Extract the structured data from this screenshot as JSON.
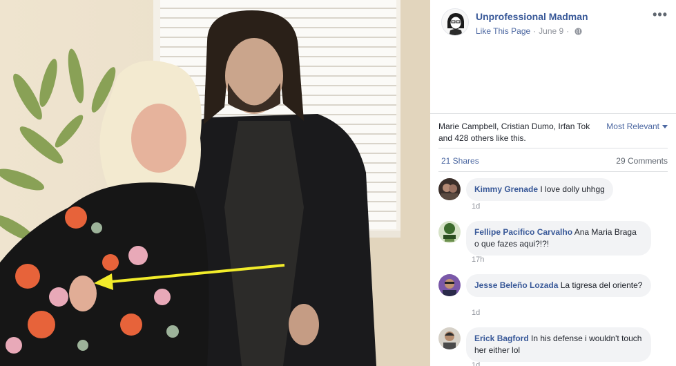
{
  "post": {
    "page_name": "Unprofessional Madman",
    "like_page_label": "Like This Page",
    "separator": "·",
    "date": "June 9",
    "privacy_icon": "globe-icon",
    "more_icon": "more-horizontal-icon"
  },
  "reactions": {
    "likes_summary": "Marie Campbell, Cristian Dumo, Irfan Tok and 428 others like this.",
    "sort_label": "Most Relevant"
  },
  "engagement": {
    "shares": "21 Shares",
    "comments": "29 Comments"
  },
  "comments": [
    {
      "author": "Kimmy Grenade",
      "text": "I love dolly uhhgg",
      "time": "1d"
    },
    {
      "author": "Fellipe Pacifico Carvalho",
      "text": "Ana Maria Braga o que fazes aqui?!?!",
      "time": "17h"
    },
    {
      "author": "Jesse Beleño Lozada",
      "text": "La tigresa del oriente?",
      "time": "1d"
    },
    {
      "author": "Erick Bagford",
      "text": "In his defense i wouldn't touch her either lol",
      "time": "1d"
    }
  ],
  "colors": {
    "link": "#385898",
    "secondary_link": "#4b67a1",
    "muted": "#90949c",
    "bubble": "#f2f3f5",
    "arrow": "#f2ec2a"
  }
}
